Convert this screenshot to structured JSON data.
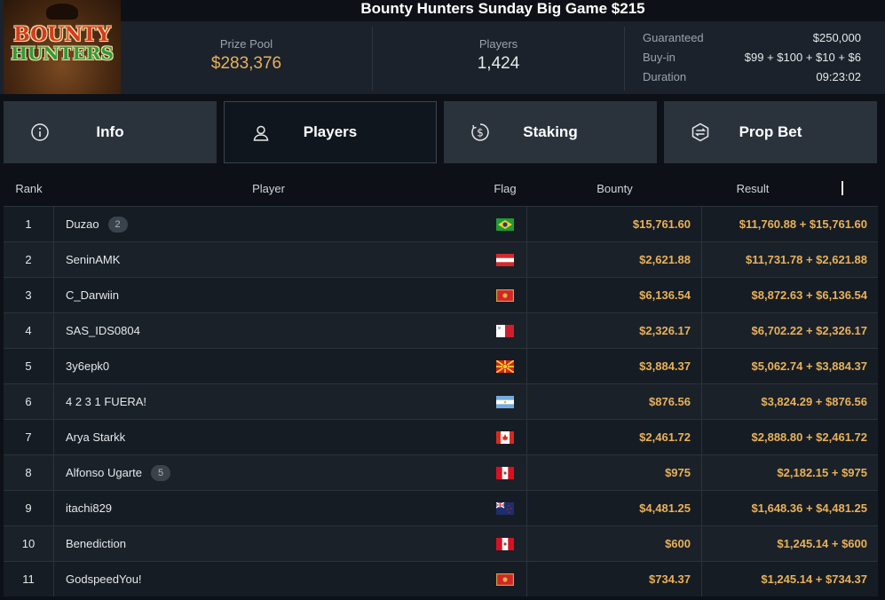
{
  "header": {
    "title": "Bounty Hunters Sunday Big Game $215",
    "logo_line1": "BOUNTY",
    "logo_line2": "HUNTERS",
    "prize_pool_label": "Prize Pool",
    "prize_pool_value": "$283,376",
    "players_label": "Players",
    "players_value": "1,424",
    "details": [
      {
        "key": "Guaranteed",
        "value": "$250,000"
      },
      {
        "key": "Buy-in",
        "value": "$99 + $100 + $10 + $6"
      },
      {
        "key": "Duration",
        "value": "09:23:02"
      }
    ]
  },
  "tabs": [
    {
      "label": "Info",
      "icon": "info-icon"
    },
    {
      "label": "Players",
      "icon": "user-icon",
      "active": true
    },
    {
      "label": "Staking",
      "icon": "dollar-circle-icon"
    },
    {
      "label": "Prop Bet",
      "icon": "prop-bet-icon"
    }
  ],
  "table": {
    "columns": {
      "rank": "Rank",
      "player": "Player",
      "flag": "Flag",
      "bounty": "Bounty",
      "result": "Result"
    },
    "rows": [
      {
        "rank": "1",
        "player": "Duzao",
        "badge": "2",
        "flag": "brazil-flag-icon",
        "bounty": "$15,761.60",
        "result": "$11,760.88 + $15,761.60"
      },
      {
        "rank": "2",
        "player": "SeninAMK",
        "badge": "",
        "flag": "austria-flag-icon",
        "bounty": "$2,621.88",
        "result": "$11,731.78 + $2,621.88"
      },
      {
        "rank": "3",
        "player": "C_Darwiin",
        "badge": "",
        "flag": "montenegro-flag-icon",
        "bounty": "$6,136.54",
        "result": "$8,872.63 + $6,136.54"
      },
      {
        "rank": "4",
        "player": "SAS_IDS0804",
        "badge": "",
        "flag": "malta-flag-icon",
        "bounty": "$2,326.17",
        "result": "$6,702.22 + $2,326.17"
      },
      {
        "rank": "5",
        "player": "3y6epk0",
        "badge": "",
        "flag": "macedonia-flag-icon",
        "bounty": "$3,884.37",
        "result": "$5,062.74 + $3,884.37"
      },
      {
        "rank": "6",
        "player": "4 2 3 1 FUERA!",
        "badge": "",
        "flag": "argentina-flag-icon",
        "bounty": "$876.56",
        "result": "$3,824.29 + $876.56"
      },
      {
        "rank": "7",
        "player": "Arya Starkk",
        "badge": "",
        "flag": "canada-flag-icon",
        "bounty": "$2,461.72",
        "result": "$2,888.80 + $2,461.72"
      },
      {
        "rank": "8",
        "player": "Alfonso Ugarte",
        "badge": "5",
        "flag": "peru-flag-icon",
        "bounty": "$975",
        "result": "$2,182.15 + $975"
      },
      {
        "rank": "9",
        "player": "itachi829",
        "badge": "",
        "flag": "new-zealand-flag-icon",
        "bounty": "$4,481.25",
        "result": "$1,648.36 + $4,481.25"
      },
      {
        "rank": "10",
        "player": "Benediction",
        "badge": "",
        "flag": "peru-flag-icon",
        "bounty": "$600",
        "result": "$1,245.14 + $600"
      },
      {
        "rank": "11",
        "player": "GodspeedYou!",
        "badge": "",
        "flag": "montenegro-flag-icon",
        "bounty": "$734.37",
        "result": "$1,245.14 + $734.37"
      }
    ]
  },
  "colors": {
    "accent_gold": "#e8b15a",
    "bg": "#0d1117",
    "panel": "#1b222b",
    "tab": "#2a323c"
  }
}
